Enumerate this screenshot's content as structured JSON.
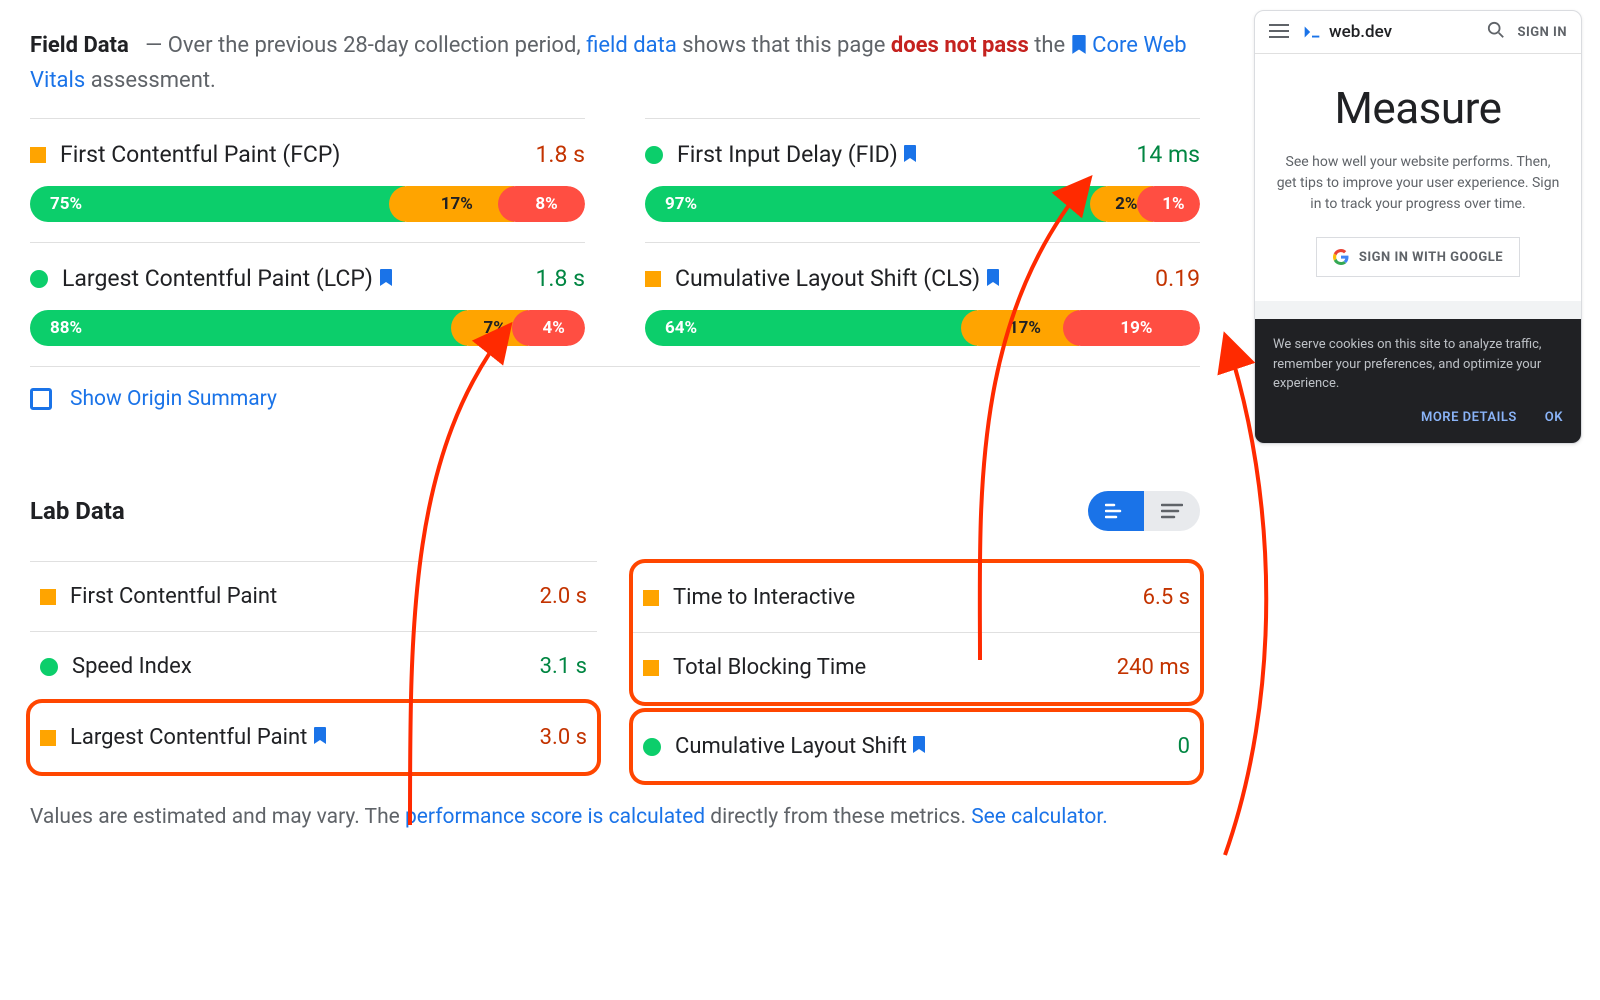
{
  "intro": {
    "title": "Field Data",
    "dash": "—",
    "text1": "Over the previous 28-day collection period,",
    "link_field_data": "field data",
    "text2": "shows that this page",
    "fail": "does not pass",
    "text3": "the",
    "link_cwv": "Core Web Vitals",
    "text4": "assessment."
  },
  "field_metrics": {
    "fcp": {
      "name": "First Contentful Paint (FCP)",
      "value": "1.8 s",
      "status": "orange",
      "dist": {
        "good": "75%",
        "ni": "17%",
        "poor": "8%",
        "gw": 75,
        "nw": 17,
        "pw": 8
      }
    },
    "lcp": {
      "name": "Largest Contentful Paint (LCP)",
      "value": "1.8 s",
      "status": "green",
      "bookmark": true,
      "dist": {
        "good": "88%",
        "ni": "7%",
        "poor": "4%",
        "gw": 88,
        "nw": 7,
        "pw": 5
      }
    },
    "fid": {
      "name": "First Input Delay (FID)",
      "value": "14 ms",
      "status": "green",
      "bookmark": true,
      "dist": {
        "good": "97%",
        "ni": "2%",
        "poor": "1%",
        "gw": 95,
        "nw": 3,
        "pw": 2
      }
    },
    "cls": {
      "name": "Cumulative Layout Shift (CLS)",
      "value": "0.19",
      "status": "orange",
      "bookmark": true,
      "dist": {
        "good": "64%",
        "ni": "17%",
        "poor": "19%",
        "gw": 64,
        "nw": 17,
        "pw": 19
      }
    }
  },
  "show_origin": "Show Origin Summary",
  "lab_header": "Lab Data",
  "lab_metrics": {
    "fcp": {
      "name": "First Contentful Paint",
      "value": "2.0 s",
      "status": "orange",
      "vcolor": "orange"
    },
    "si": {
      "name": "Speed Index",
      "value": "3.1 s",
      "status": "green",
      "vcolor": "green"
    },
    "lcp": {
      "name": "Largest Contentful Paint",
      "value": "3.0 s",
      "status": "orange",
      "vcolor": "orange",
      "bookmark": true
    },
    "tti": {
      "name": "Time to Interactive",
      "value": "6.5 s",
      "status": "orange",
      "vcolor": "orange"
    },
    "tbt": {
      "name": "Total Blocking Time",
      "value": "240 ms",
      "status": "orange",
      "vcolor": "orange"
    },
    "cls": {
      "name": "Cumulative Layout Shift",
      "value": "0",
      "status": "green",
      "vcolor": "green",
      "bookmark": true
    }
  },
  "footnote": {
    "text1": "Values are estimated and may vary. The",
    "link1": "performance score is calculated",
    "text2": "directly from these metrics.",
    "link2": "See calculator."
  },
  "mobile": {
    "brand": "web.dev",
    "signin": "SIGN IN",
    "title": "Measure",
    "desc": "See how well your website performs. Then, get tips to improve your user experience. Sign in to track your progress over time.",
    "btn": "SIGN IN WITH GOOGLE",
    "cookie_text": "We serve cookies on this site to analyze traffic, remember your preferences, and optimize your experience.",
    "more": "MORE DETAILS",
    "ok": "OK"
  }
}
